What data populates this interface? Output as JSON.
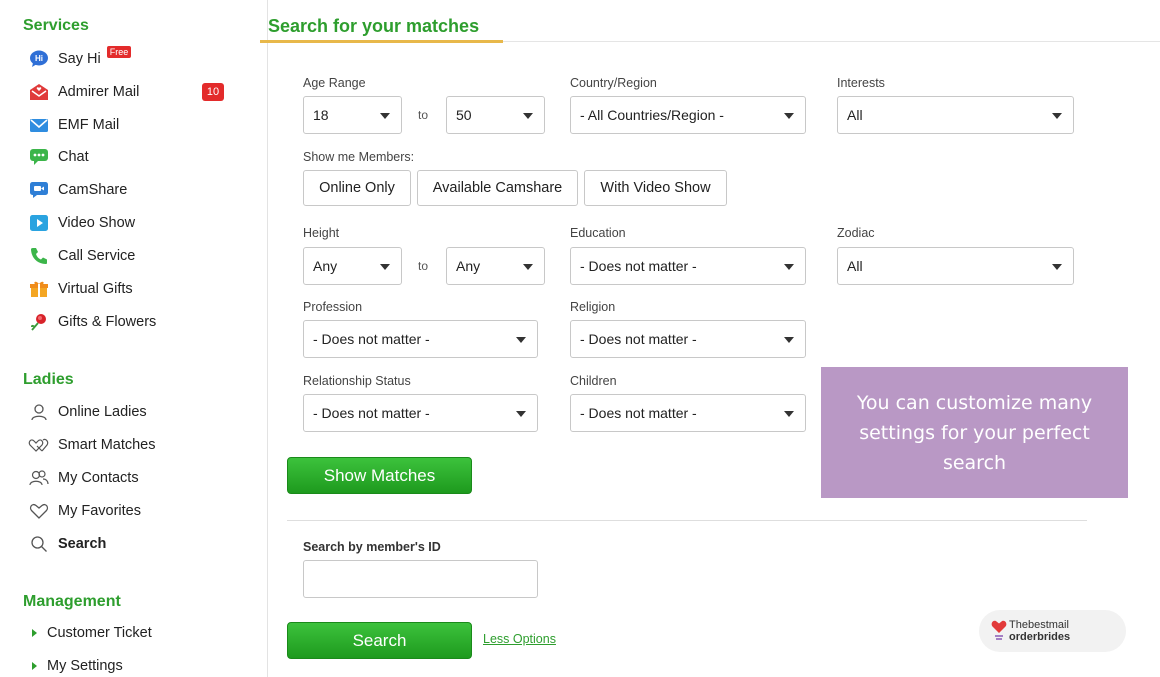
{
  "sidebar": {
    "services": {
      "title": "Services",
      "items": [
        {
          "label": "Say Hi",
          "badge": "Free",
          "icon": "say-hi-icon"
        },
        {
          "label": "Admirer Mail",
          "count": "10",
          "icon": "admirer-mail-icon"
        },
        {
          "label": "EMF Mail",
          "icon": "emf-mail-icon"
        },
        {
          "label": "Chat",
          "icon": "chat-icon"
        },
        {
          "label": "CamShare",
          "icon": "camshare-icon"
        },
        {
          "label": "Video Show",
          "icon": "video-show-icon"
        },
        {
          "label": "Call Service",
          "icon": "phone-icon"
        },
        {
          "label": "Virtual Gifts",
          "icon": "gift-icon"
        },
        {
          "label": "Gifts & Flowers",
          "icon": "flower-icon"
        }
      ]
    },
    "ladies": {
      "title": "Ladies",
      "items": [
        {
          "label": "Online Ladies",
          "icon": "person-icon"
        },
        {
          "label": "Smart Matches",
          "icon": "hearts-icon"
        },
        {
          "label": "My Contacts",
          "icon": "contacts-icon"
        },
        {
          "label": "My Favorites",
          "icon": "heart-icon"
        },
        {
          "label": "Search",
          "icon": "search-icon"
        }
      ]
    },
    "management": {
      "title": "Management",
      "items": [
        {
          "label": "Customer Ticket"
        },
        {
          "label": "My Settings"
        }
      ]
    }
  },
  "main": {
    "title": "Search for your matches",
    "to_label": "to",
    "age": {
      "label": "Age Range",
      "min": "18",
      "max": "50"
    },
    "country": {
      "label": "Country/Region",
      "value": "- All Countries/Region -"
    },
    "interests": {
      "label": "Interests",
      "value": "All"
    },
    "show_members": {
      "label": "Show me Members:",
      "options": [
        "Online Only",
        "Available Camshare",
        "With Video Show"
      ]
    },
    "height": {
      "label": "Height",
      "min": "Any",
      "max": "Any"
    },
    "education": {
      "label": "Education",
      "value": "- Does not matter -"
    },
    "zodiac": {
      "label": "Zodiac",
      "value": "All"
    },
    "profession": {
      "label": "Profession",
      "value": "- Does not matter -"
    },
    "religion": {
      "label": "Religion",
      "value": "- Does not matter -"
    },
    "relationship": {
      "label": "Relationship Status",
      "value": "- Does not matter -"
    },
    "children": {
      "label": "Children",
      "value": "- Does not matter -"
    },
    "show_matches_button": "Show Matches",
    "member_id": {
      "label": "Search by member's ID",
      "value": ""
    },
    "search_button": "Search",
    "less_options": "Less Options"
  },
  "note": "You can customize many settings for your perfect search",
  "brand": {
    "line1": "Thebestmail",
    "line2": "orderbrides",
    "icon": "heart-logo-icon"
  },
  "colors": {
    "accent_green": "#2e9e2e",
    "badge_red": "#e32b2b",
    "note_purple": "#b998c5",
    "underline_gold": "#e8b84a"
  }
}
